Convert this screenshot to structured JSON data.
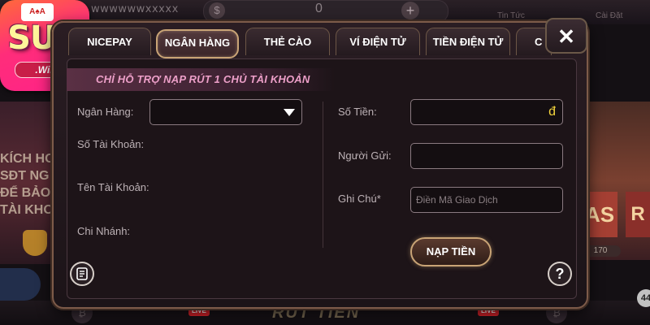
{
  "background": {
    "username": "wwwwwwxxxxx",
    "balance": "0",
    "top_items": [
      "Tin Tức",
      "Cài Đặt"
    ],
    "left_banner_lines": [
      "KÍCH HO",
      "SĐT NG",
      "ĐỂ BẢO",
      "TÀI KHO"
    ],
    "right_card": "AS",
    "right_card2": "R",
    "right_count": "170",
    "bottom_center": "RÚT TIỀN",
    "live_badge": "LIVE",
    "corner_badge": "44"
  },
  "logo": {
    "text": "SUN",
    "ribbon": ".Win",
    "cards": "A♠A"
  },
  "modal": {
    "tabs": [
      {
        "label": "NICEPAY",
        "active": false
      },
      {
        "label": "NGÂN HÀNG",
        "active": true
      },
      {
        "label": "THẺ CÀO",
        "active": false
      },
      {
        "label": "VÍ ĐIỆN TỬ",
        "active": false
      },
      {
        "label": "TIỀN ĐIỆN TỬ",
        "active": false
      },
      {
        "label": "C",
        "active": false
      }
    ],
    "close_glyph": "✕",
    "notice": "CHỈ HỖ TRỢ NẠP RÚT 1 CHỦ TÀI KHOẢN",
    "left_form": {
      "bank_label": "Ngân Hàng:",
      "bank_value": "",
      "account_number_label": "Số Tài Khoản:",
      "account_name_label": "Tên Tài Khoản:",
      "branch_label": "Chi Nhánh:"
    },
    "right_form": {
      "amount_label": "Số Tiền:",
      "amount_currency": "đ",
      "sender_label": "Người Gửi:",
      "note_label": "Ghi Chú*",
      "note_placeholder": "Điền Mã Giao Dịch"
    },
    "submit_label": "NẠP TIỀN",
    "help_glyph": "?"
  }
}
